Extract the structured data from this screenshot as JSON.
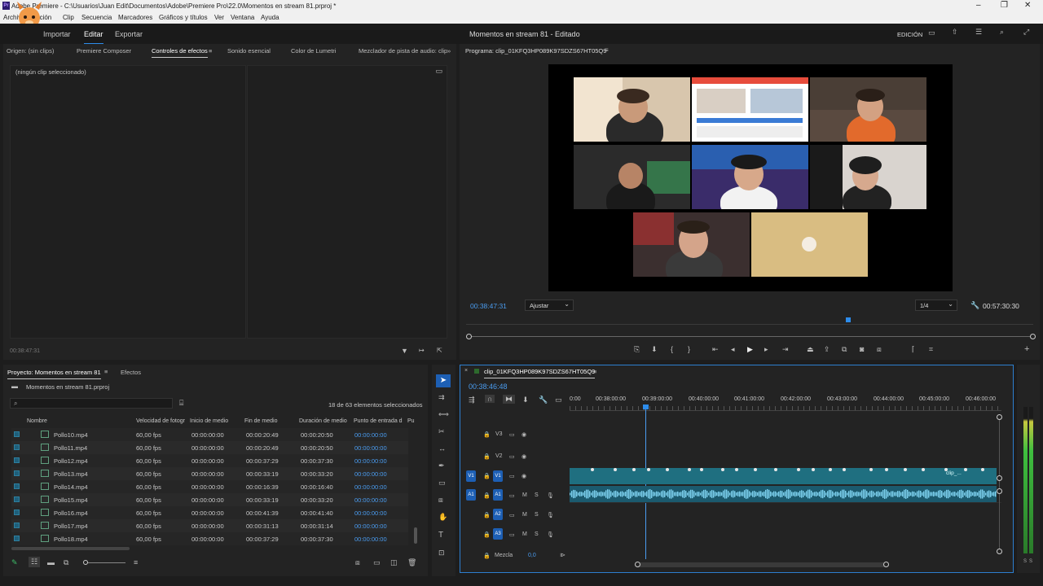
{
  "window": {
    "title": "Adobe Premiere - C:\\Usuarios\\Juan Edit\\Documentos\\Adobe\\Premiere Pro\\22.0\\Momentos en stream 81.prproj *",
    "app_icon": "Pr"
  },
  "menu": [
    "Archivo",
    "Edición",
    "Clip",
    "Secuencia",
    "Marcadores",
    "Gráficos y títulos",
    "Ver",
    "Ventana",
    "Ayuda"
  ],
  "header": {
    "tabs": [
      "Importar",
      "Editar",
      "Exportar"
    ],
    "active_tab": "Editar",
    "project_title": "Momentos en stream 81",
    "project_status": "Editado",
    "workspace": "EDICIÓN"
  },
  "source_panel": {
    "tabs": [
      "Origen: (sin clips)",
      "Premiere Composer",
      "Controles de efectos",
      "Sonido esencial",
      "Color de Lumetri",
      "Mezclador de pista de audio: clip"
    ],
    "active_tab": "Controles de efectos",
    "no_clip": "(ningún clip seleccionado)",
    "timecode": "00:38:47:31"
  },
  "program": {
    "title": "Programa: clip_01KFQ3HP089K97SDZS67HT05Q9",
    "timecode": "00:38:47:31",
    "fit": "Ajustar",
    "resolution": "1/4",
    "duration": "00:57:30:30",
    "playhead_fraction": 0.67
  },
  "project": {
    "tabs": [
      "Proyecto: Momentos en stream 81",
      "Efectos"
    ],
    "file": "Momentos en stream 81.prproj",
    "selected_count": "18 de 63 elementos seleccionados",
    "columns": [
      "Nombre",
      "Velocidad de fotogr",
      "Inicio de medio",
      "Fin de medio",
      "Duración de medio",
      "Punto de entrada d",
      "Pu"
    ],
    "rows": [
      {
        "name": "Pollo10.mp4",
        "fps": "60,00 fps",
        "start": "00:00:00:00",
        "end": "00:00:20:49",
        "dur": "00:00:20:50",
        "in": "00:00:00:00"
      },
      {
        "name": "Pollo11.mp4",
        "fps": "60,00 fps",
        "start": "00:00:00:00",
        "end": "00:00:20:49",
        "dur": "00:00:20:50",
        "in": "00:00:00:00"
      },
      {
        "name": "Pollo12.mp4",
        "fps": "60,00 fps",
        "start": "00:00:00:00",
        "end": "00:00:37:29",
        "dur": "00:00:37:30",
        "in": "00:00:00:00"
      },
      {
        "name": "Pollo13.mp4",
        "fps": "60,00 fps",
        "start": "00:00:00:00",
        "end": "00:00:33:19",
        "dur": "00:00:33:20",
        "in": "00:00:00:00"
      },
      {
        "name": "Pollo14.mp4",
        "fps": "60,00 fps",
        "start": "00:00:00:00",
        "end": "00:00:16:39",
        "dur": "00:00:16:40",
        "in": "00:00:00:00"
      },
      {
        "name": "Pollo15.mp4",
        "fps": "60,00 fps",
        "start": "00:00:00:00",
        "end": "00:00:33:19",
        "dur": "00:00:33:20",
        "in": "00:00:00:00"
      },
      {
        "name": "Pollo16.mp4",
        "fps": "60,00 fps",
        "start": "00:00:00:00",
        "end": "00:00:41:39",
        "dur": "00:00:41:40",
        "in": "00:00:00:00"
      },
      {
        "name": "Pollo17.mp4",
        "fps": "60,00 fps",
        "start": "00:00:00:00",
        "end": "00:00:31:13",
        "dur": "00:00:31:14",
        "in": "00:00:00:00"
      },
      {
        "name": "Pollo18.mp4",
        "fps": "60,00 fps",
        "start": "00:00:00:00",
        "end": "00:00:37:29",
        "dur": "00:00:37:30",
        "in": "00:00:00:00"
      }
    ]
  },
  "timeline": {
    "sequence": "clip_01KFQ3HP089K97SDZS67HT05Q9",
    "timecode": "00:38:46:48",
    "ruler": [
      "0:00",
      "00:38:00:00",
      "00:39:00:00",
      "00:40:00:00",
      "00:41:00:00",
      "00:42:00:00",
      "00:43:00:00",
      "00:44:00:00",
      "00:45:00:00",
      "00:46:00:00"
    ],
    "video_tracks": [
      "V3",
      "V2",
      "V1"
    ],
    "audio_tracks": [
      "A1",
      "A2",
      "A3"
    ],
    "source_patch_v": "V1",
    "source_patch_a": "A1",
    "mute": "M",
    "solo": "S",
    "clip_label": "clip_...",
    "mix_label": "Mezcla",
    "mix_value": "0,0"
  },
  "meter": {
    "labels": [
      "S",
      "S"
    ]
  },
  "colors": {
    "accent": "#2d8ceb",
    "clip_video": "#1f6f80",
    "clip_audio": "#3fa9d6",
    "panel": "#232323"
  }
}
